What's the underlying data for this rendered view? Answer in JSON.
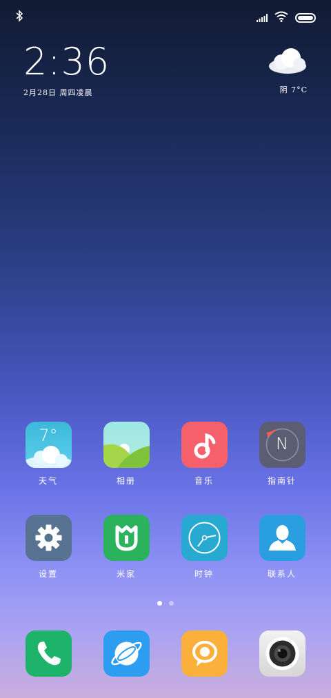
{
  "status_bar": {
    "icons": [
      "bluetooth-icon",
      "signal-icon",
      "wifi-icon",
      "battery-icon"
    ]
  },
  "lockwidget": {
    "time": "2:36",
    "date": "2月28日 周四凌晨",
    "weather_icon": "cloud-icon",
    "weather_text": "阴  7°C"
  },
  "apps_row1": [
    {
      "label": "天气",
      "icon": "weather-icon",
      "temp": "7°"
    },
    {
      "label": "相册",
      "icon": "gallery-icon"
    },
    {
      "label": "音乐",
      "icon": "music-icon"
    },
    {
      "label": "指南针",
      "icon": "compass-icon",
      "letter": "N"
    }
  ],
  "apps_row2": [
    {
      "label": "设置",
      "icon": "settings-gear-icon"
    },
    {
      "label": "米家",
      "icon": "mijia-icon"
    },
    {
      "label": "时钟",
      "icon": "clock-icon"
    },
    {
      "label": "联系人",
      "icon": "contacts-icon"
    }
  ],
  "page_indicator": {
    "pages": 2,
    "active": 1
  },
  "dock": [
    {
      "icon": "phone-icon",
      "color": "#1db36a"
    },
    {
      "icon": "browser-icon",
      "color": "#2c9df0"
    },
    {
      "icon": "messages-icon",
      "color": "#fbb03b"
    },
    {
      "icon": "camera-icon",
      "color": "#e6e6e6"
    }
  ],
  "colors": {
    "weather": "#45c4e6",
    "gallery": "#8bd9a8",
    "music": "#f5606a",
    "compass": "#5b5e73",
    "settings": "#587291",
    "mijia": "#2ab35c",
    "clock": "#27a9d1",
    "contacts": "#2a9fe0"
  }
}
